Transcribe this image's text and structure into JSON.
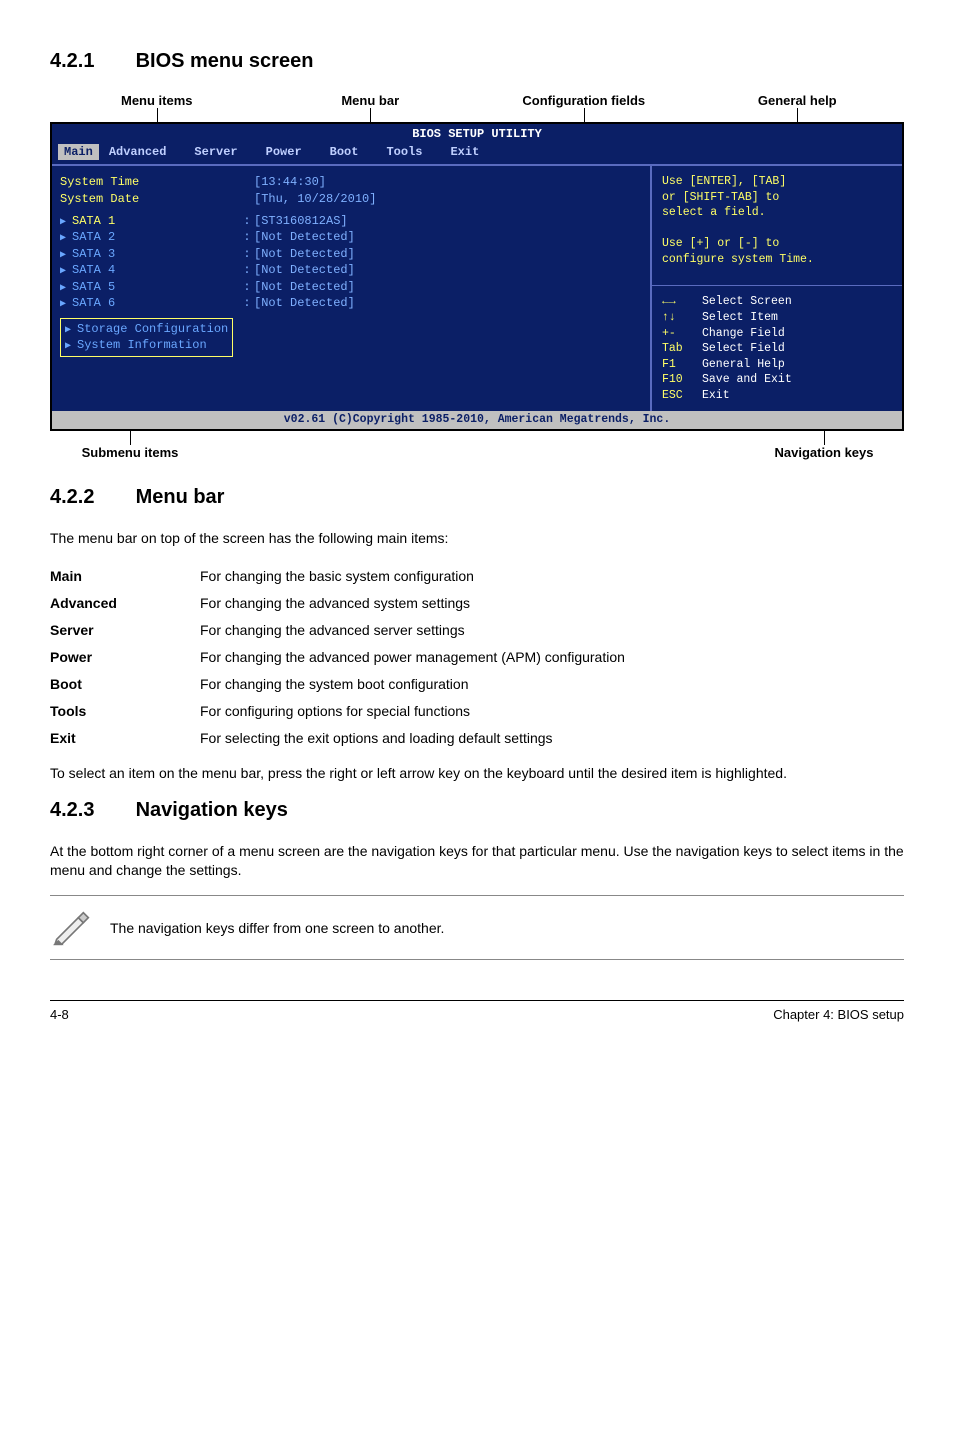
{
  "sections": {
    "s1": {
      "num": "4.2.1",
      "title": "BIOS menu screen"
    },
    "s2": {
      "num": "4.2.2",
      "title": "Menu bar"
    },
    "s3": {
      "num": "4.2.3",
      "title": "Navigation keys"
    }
  },
  "upperLabels": [
    "Menu items",
    "Menu bar",
    "Configuration fields",
    "General help"
  ],
  "lowerLabels": {
    "left": "Submenu items",
    "right": "Navigation keys"
  },
  "bios": {
    "title": "BIOS SETUP UTILITY",
    "menu": [
      "Main",
      "Advanced",
      "Server",
      "Power",
      "Boot",
      "Tools",
      "Exit"
    ],
    "selectedMenu": "Main",
    "fields": [
      {
        "label": "System Time",
        "val": "[13:44:30]",
        "hover": true
      },
      {
        "label": "System Date",
        "val": "[Thu, 10/28/2010]",
        "hover": false
      }
    ],
    "sata": [
      {
        "label": "SATA 1",
        "val": "[ST3160812AS]",
        "hover": true
      },
      {
        "label": "SATA 2",
        "val": "[Not Detected]"
      },
      {
        "label": "SATA 3",
        "val": "[Not Detected]"
      },
      {
        "label": "SATA 4",
        "val": "[Not Detected]"
      },
      {
        "label": "SATA 5",
        "val": "[Not Detected]"
      },
      {
        "label": "SATA 6",
        "val": "[Not Detected]"
      }
    ],
    "submenus": [
      "Storage Configuration",
      "System Information"
    ],
    "helpTop": [
      "Use [ENTER], [TAB]",
      "or [SHIFT-TAB] to",
      "select a field.",
      "",
      "Use [+] or [-] to",
      "configure system Time."
    ],
    "helpKeys": [
      {
        "k": "←→",
        "d": "Select Screen"
      },
      {
        "k": "↑↓",
        "d": "Select Item"
      },
      {
        "k": "+-",
        "d": "Change Field"
      },
      {
        "k": "Tab",
        "d": "Select Field"
      },
      {
        "k": "F1",
        "d": "General Help"
      },
      {
        "k": "F10",
        "d": "Save and Exit"
      },
      {
        "k": "ESC",
        "d": "Exit"
      }
    ],
    "footer": "v02.61 (C)Copyright 1985-2010, American Megatrends, Inc."
  },
  "menuBarIntro": "The menu bar on top of the screen has the following main items:",
  "menuTable": [
    {
      "k": "Main",
      "d": "For changing the basic system configuration"
    },
    {
      "k": "Advanced",
      "d": "For changing the advanced system settings"
    },
    {
      "k": "Server",
      "d": "For changing the advanced server settings"
    },
    {
      "k": "Power",
      "d": "For changing the advanced power management (APM) configuration"
    },
    {
      "k": "Boot",
      "d": "For changing the system boot configuration"
    },
    {
      "k": "Tools",
      "d": "For configuring options for special functions"
    },
    {
      "k": "Exit",
      "d": "For selecting the exit options and loading default settings"
    }
  ],
  "menuBarOutro": "To select an item on the menu bar, press the right or left arrow key on the keyboard until the desired item is highlighted.",
  "navKeysText": "At the bottom right corner of a menu screen are the navigation keys for that particular menu. Use the navigation keys to select items in the menu and change the settings.",
  "noteText": "The navigation keys differ from one screen to another.",
  "footer": {
    "left": "4-8",
    "right": "Chapter 4: BIOS setup"
  }
}
